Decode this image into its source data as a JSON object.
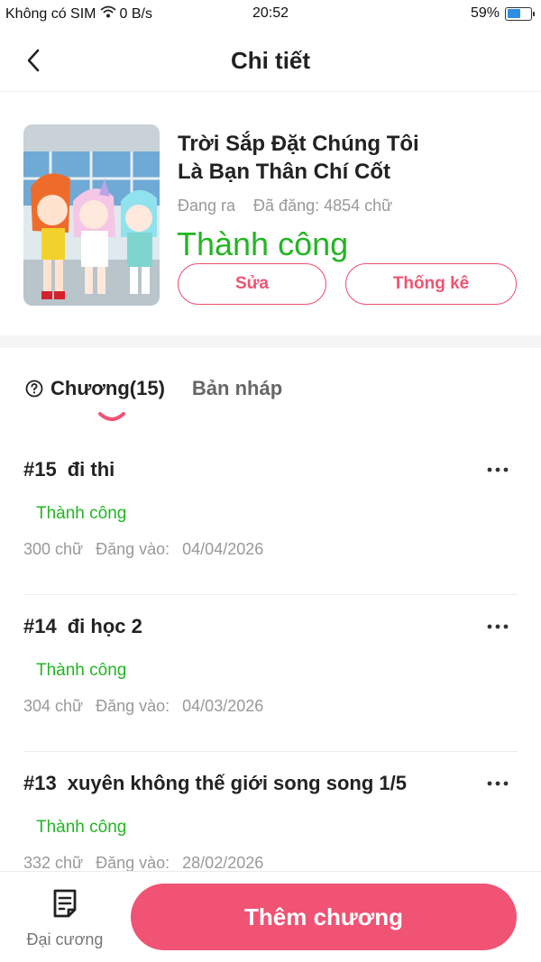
{
  "status_bar": {
    "carrier": "Không có SIM",
    "speed": "0 B/s",
    "time": "20:52",
    "battery": "59%",
    "battery_level": 0.59,
    "battery_color": "#2f8de4"
  },
  "header": {
    "title": "Chi tiết",
    "back_icon": "chevron-left-icon"
  },
  "book": {
    "title_line1": "Trời Sắp Đặt Chúng Tôi",
    "title_line2": "Là Bạn Thân Chí Cốt",
    "state": "Đang ra",
    "words": "Đã đăng: 4854 chữ",
    "status": "Thành công",
    "edit_label": "Sửa",
    "stats_label": "Thống kê"
  },
  "tabs": {
    "chapters_label": "Chương(15)",
    "drafts_label": "Bản nháp"
  },
  "chapters": [
    {
      "num": "#15",
      "title": "đi thi",
      "status": "Thành công",
      "words": "300 chữ",
      "posted_label": "Đăng vào:",
      "date": "04/04/2026"
    },
    {
      "num": "#14",
      "title": "đi học 2",
      "status": "Thành công",
      "words": "304 chữ",
      "posted_label": "Đăng vào:",
      "date": "04/03/2026"
    },
    {
      "num": "#13",
      "title": "xuyên không thế giới song song 1/5",
      "status": "Thành công",
      "words": "332 chữ",
      "posted_label": "Đăng vào:",
      "date": "28/02/2026"
    }
  ],
  "bottom": {
    "outline_label": "Đại cương",
    "outline_icon": "document-icon",
    "add_label": "Thêm chương"
  },
  "colors": {
    "accent": "#f05373",
    "success": "#22b522"
  }
}
